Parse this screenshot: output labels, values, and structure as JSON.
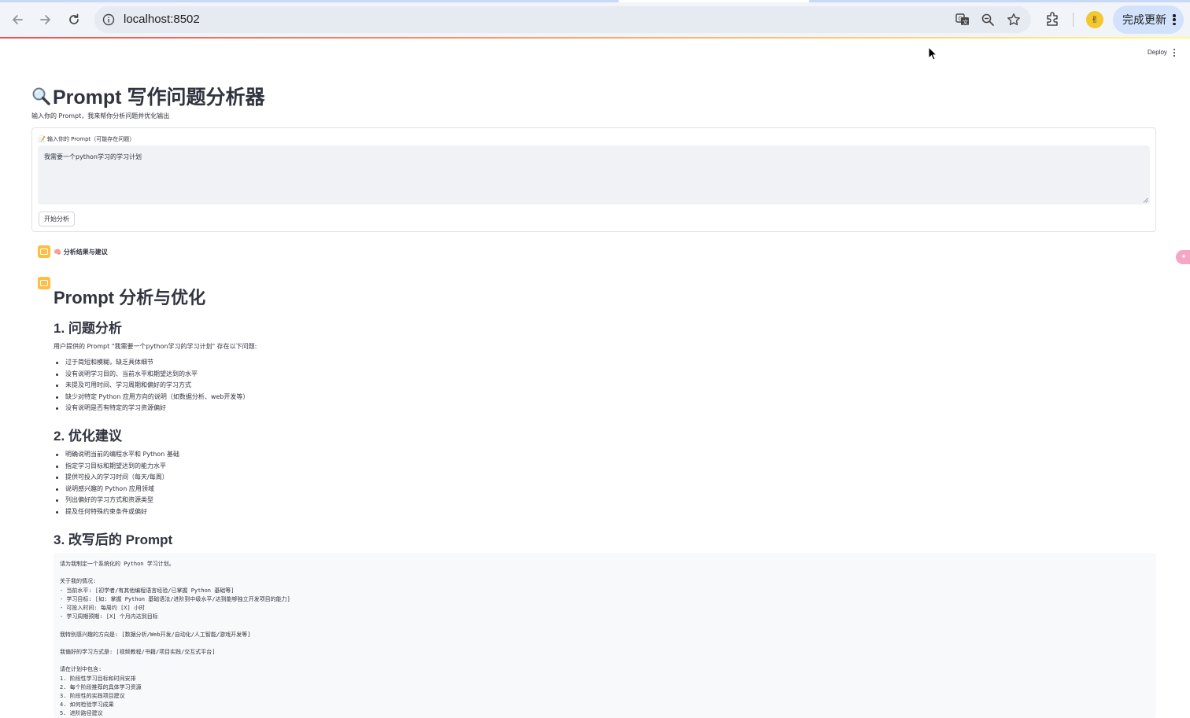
{
  "browser": {
    "url": "localhost:8502",
    "update_label": "完成更新",
    "avatar_glyph": "✌"
  },
  "streamlit": {
    "deploy_label": "Deploy"
  },
  "page": {
    "title": "Prompt 写作问题分析器",
    "subtitle": "输入你的 Prompt，我来帮你分析问题并优化输出",
    "input_label": "📝 输入你的 Prompt（可能存在问题）",
    "input_value": "我需要一个python学习的学习计划",
    "submit_label": "开始分析"
  },
  "result": {
    "header": "🧠 分析结果与建议",
    "h1": "Prompt 分析与优化",
    "sections": [
      {
        "heading": "1. 问题分析",
        "intro": "用户提供的 Prompt \"我需要一个python学习的学习计划\" 存在以下问题:",
        "items": [
          "过于简短和模糊，缺乏具体细节",
          "没有说明学习目的、当前水平和期望达到的水平",
          "未提及可用时间、学习周期和偏好的学习方式",
          "缺少对特定 Python 应用方向的说明（如数据分析、web开发等）",
          "没有说明是否有特定的学习资源偏好"
        ]
      },
      {
        "heading": "2. 优化建议",
        "items": [
          "明确说明当前的编程水平和 Python 基础",
          "指定学习目标和期望达到的能力水平",
          "提供可投入的学习时间（每天/每周）",
          "说明感兴趣的 Python 应用领域",
          "列出偏好的学习方式和资源类型",
          "提及任何特殊约束条件或偏好"
        ]
      },
      {
        "heading": "3. 改写后的 Prompt",
        "code": "请为我制定一个系统化的 Python 学习计划。\n\n关于我的情况:\n- 当前水平: [初学者/有其他编程语言经验/已掌握 Python 基础等]\n- 学习目标: [如: 掌握 Python 基础语法/进阶到中级水平/达到能够独立开发项目的能力]\n- 可投入时间: 每周约 [X] 小时\n- 学习周期预期: [X] 个月内达到目标\n\n我特别感兴趣的方向是: [数据分析/Web开发/自动化/人工智能/游戏开发等]\n\n我偏好的学习方式是: [视频教程/书籍/项目实践/交互式平台]\n\n请在计划中包含:\n1. 阶段性学习目标和时间安排\n2. 每个阶段推荐的具体学习资源\n3. 阶段性的实践项目建议\n4. 如何检验学习成果\n5. 进阶路径建议"
      }
    ]
  }
}
